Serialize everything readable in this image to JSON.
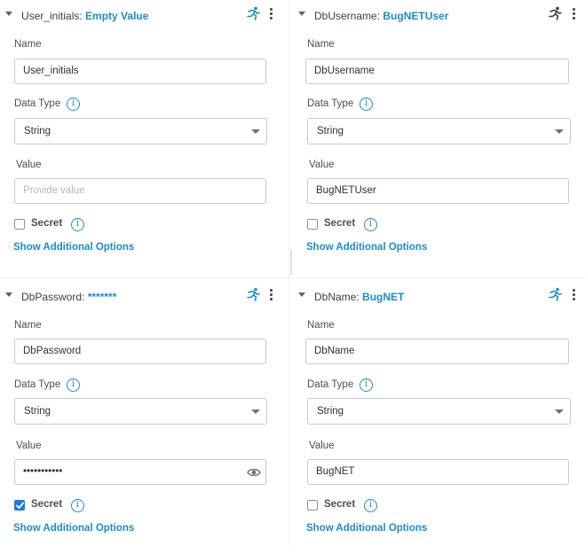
{
  "labels": {
    "name": "Name",
    "data_type": "Data Type",
    "value": "Value",
    "secret": "Secret",
    "show_additional": "Show Additional Options",
    "info_glyph": "i"
  },
  "icons": {
    "runner": "running-man-icon",
    "menu": "vertical-ellipsis-icon",
    "info": "info-circle-icon",
    "eye": "eye-icon",
    "caret": "caret-down-icon"
  },
  "colors": {
    "accent": "#1b8dc6",
    "checkbox_checked": "#1f7ae0",
    "border": "#c5c9ce"
  },
  "panels": [
    {
      "title_name": "User_initials:",
      "title_value": "Empty Value",
      "name_value": "User_initials",
      "data_type": "String",
      "value": "",
      "value_placeholder": "Provide value",
      "secret": false
    },
    {
      "title_name": "DbUsername:",
      "title_value": "BugNETUser",
      "name_value": "DbUsername",
      "data_type": "String",
      "value": "BugNETUser",
      "value_placeholder": "",
      "secret": false
    },
    {
      "title_name": "DbPassword:",
      "title_value": "*******",
      "name_value": "DbPassword",
      "data_type": "String",
      "value": "•••••••••••",
      "value_placeholder": "",
      "secret": true
    },
    {
      "title_name": "DbName:",
      "title_value": "BugNET",
      "name_value": "DbName",
      "data_type": "String",
      "value": "BugNET",
      "value_placeholder": "",
      "secret": false
    }
  ]
}
